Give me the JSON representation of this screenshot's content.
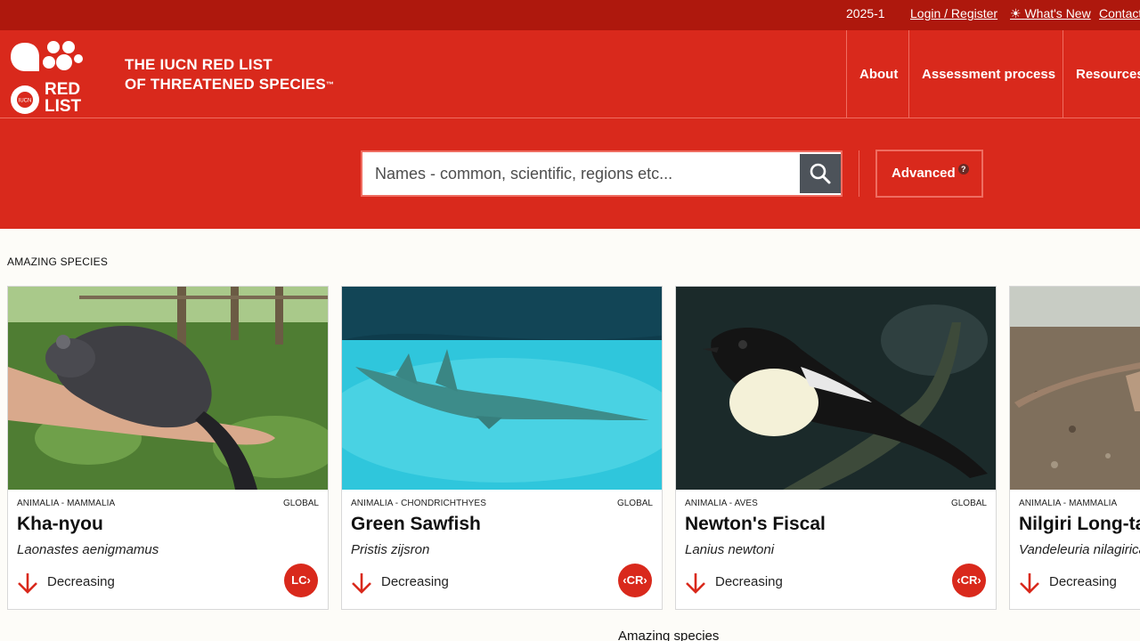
{
  "topbar": {
    "version": "2025-1",
    "login": "Login / Register",
    "whats_new": "What's New",
    "whats_new_icon": "sun-icon",
    "contact": "Contact"
  },
  "header": {
    "logo_text": [
      "RED",
      "LIST"
    ],
    "logo_badge": "IUCN",
    "brand_line1": "THE IUCN RED LIST",
    "brand_line2": "OF THREATENED SPECIES",
    "brand_tm": "™",
    "nav": [
      "About",
      "Assessment process",
      "Resources"
    ]
  },
  "search": {
    "placeholder": "Names - common, scientific, regions etc...",
    "value": "",
    "button_icon": "search-icon",
    "advanced_label": "Advanced",
    "advanced_help": "?"
  },
  "section": {
    "title": "AMAZING SPECIES",
    "footer_title": "Amazing species"
  },
  "colors": {
    "topbar": "#ae180d",
    "brand_red": "#d9291c",
    "search_button": "#4d535a",
    "page_background": "#fdfcf8"
  },
  "species": [
    {
      "taxon": "ANIMALIA - MAMMALIA",
      "scope": "GLOBAL",
      "common_name": "Kha-nyou",
      "scientific_name": "Laonastes aenigmamus",
      "trend": "Decreasing",
      "trend_icon": "arrow-down-icon",
      "status": "LC"
    },
    {
      "taxon": "ANIMALIA - CHONDRICHTHYES",
      "scope": "GLOBAL",
      "common_name": "Green Sawfish",
      "scientific_name": "Pristis zijsron",
      "trend": "Decreasing",
      "trend_icon": "arrow-down-icon",
      "status": "CR"
    },
    {
      "taxon": "ANIMALIA - AVES",
      "scope": "GLOBAL",
      "common_name": "Newton's Fiscal",
      "scientific_name": "Lanius newtoni",
      "trend": "Decreasing",
      "trend_icon": "arrow-down-icon",
      "status": "CR"
    },
    {
      "taxon": "ANIMALIA - MAMMALIA",
      "scope": "",
      "common_name": "Nilgiri Long-ta",
      "scientific_name": "Vandeleuria nilagirica",
      "trend": "Decreasing",
      "trend_icon": "arrow-down-icon",
      "status": ""
    }
  ]
}
